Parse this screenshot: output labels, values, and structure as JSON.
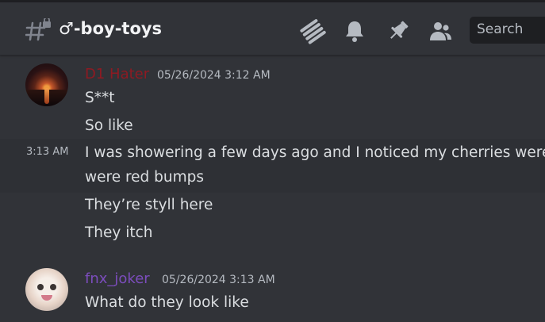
{
  "header": {
    "channel_name": "♂-boy-toys",
    "search_placeholder": "Search",
    "icons": [
      "threads-icon",
      "bell-icon",
      "pin-icon",
      "members-icon"
    ]
  },
  "messages": [
    {
      "username": "D1 Hater",
      "username_color": "#8e1a22",
      "timestamp": "05/26/2024 3:12 AM",
      "lines": [
        "S**t",
        "So like"
      ]
    },
    {
      "side_timestamp": "3:13 AM",
      "lines": [
        "I was showering a few days ago and I noticed my cherries were it",
        "were red bumps",
        "They’re styll here",
        "They itch"
      ]
    },
    {
      "username": "fnx_joker",
      "username_color": "#7c4dbd",
      "timestamp": "05/26/2024 3:13 AM",
      "lines": [
        "What do they look like"
      ]
    }
  ]
}
